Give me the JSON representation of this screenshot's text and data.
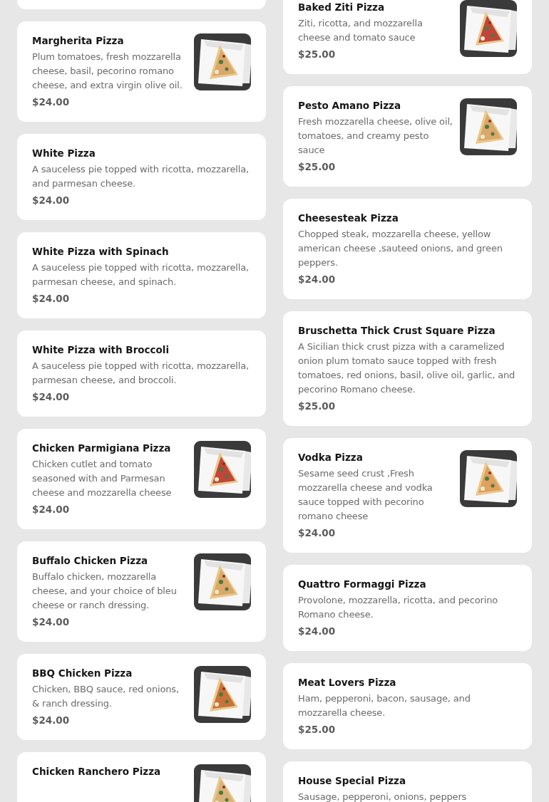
{
  "columns": [
    {
      "items": [
        {
          "kind": "blank"
        },
        {
          "kind": "dish",
          "name": "Margherita Pizza",
          "description": "Plum tomatoes, fresh mozzarella cheese, basil, pecorino romano cheese, and extra virgin olive oil.",
          "price": "$24.00"
        },
        {
          "kind": "dish",
          "name": "White Pizza",
          "description": "A sauceless pie topped with ricotta, mozzarella, and parmesan cheese.",
          "price": "$24.00"
        },
        {
          "kind": "dish",
          "name": "White Pizza with Spinach",
          "description": "A sauceless pie topped with ricotta, mozzarella, parmesan cheese, and spinach.",
          "price": "$24.00"
        },
        {
          "kind": "dish",
          "name": "White Pizza with Broccoli",
          "description": "A sauceless pie topped with ricotta, mozzarella, parmesan cheese, and broccoli.",
          "price": "$24.00"
        },
        {
          "kind": "dish",
          "name": "Chicken Parmigiana Pizza",
          "description": "Chicken cutlet and tomato seasoned with and Parmesan cheese and mozzarella cheese",
          "price": "$24.00"
        },
        {
          "kind": "dish",
          "name": "Buffalo Chicken Pizza",
          "description": "Buffalo chicken, mozzarella cheese, and your choice of bleu cheese or ranch dressing.",
          "price": "$24.00"
        },
        {
          "kind": "dish",
          "name": "BBQ Chicken Pizza",
          "description": "Chicken, BBQ sauce, red onions, & ranch dressing.",
          "price": "$24.00"
        },
        {
          "kind": "dish",
          "name": "Chicken Ranchero Pizza"
        }
      ]
    },
    {
      "items": [
        {
          "kind": "dish",
          "name": "Baked Ziti Pizza",
          "description": "Ziti, ricotta, and mozzarella cheese and tomato sauce",
          "price": "$25.00"
        },
        {
          "kind": "dish",
          "name": "Pesto Amano Pizza",
          "description": "Fresh mozzarella cheese, olive oil, tomatoes, and creamy pesto sauce",
          "price": "$25.00"
        },
        {
          "kind": "dish",
          "name": "Cheesesteak Pizza",
          "description": "Chopped steak, mozzarella cheese, yellow american cheese ,sauteed onions, and green peppers.",
          "price": "$24.00"
        },
        {
          "kind": "dish",
          "name": "Bruschetta Thick Crust Square Pizza",
          "description": "A Sicilian thick crust pizza with a caramelized onion plum tomato sauce topped with fresh tomatoes, red onions, basil, olive oil, garlic, and pecorino Romano cheese.",
          "price": "$25.00"
        },
        {
          "kind": "dish",
          "name": "Vodka Pizza",
          "description": "Sesame seed crust ,Fresh mozzarella cheese and vodka sauce topped with pecorino romano cheese",
          "price": "$24.00"
        },
        {
          "kind": "dish",
          "name": "Quattro Formaggi Pizza",
          "description": "Provolone, mozzarella, ricotta, and pecorino Romano cheese.",
          "price": "$24.00"
        },
        {
          "kind": "dish",
          "name": "Meat Lovers Pizza",
          "description": "Ham, pepperoni, bacon, sausage, and mozzarella cheese.",
          "price": "$25.00"
        },
        {
          "kind": "dish",
          "name": "House Special Pizza",
          "description": "Sausage, pepperoni, onions, peppers"
        }
      ]
    }
  ]
}
